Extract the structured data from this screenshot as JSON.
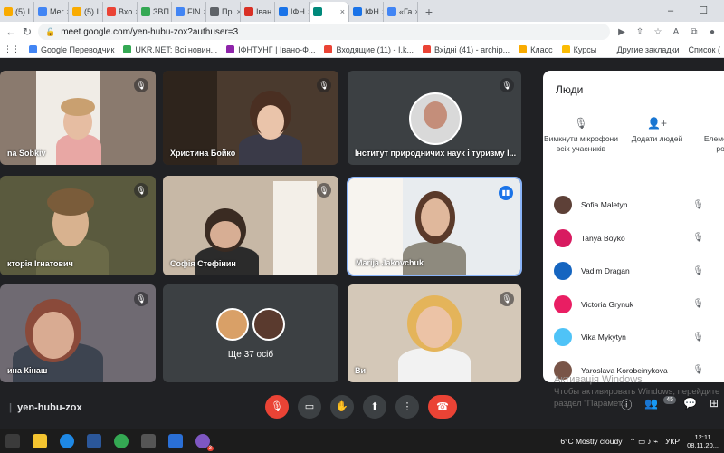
{
  "browser": {
    "tabs": [
      {
        "label": "(5) I",
        "color": "#f9ab00"
      },
      {
        "label": "Mer",
        "color": "#4285f4"
      },
      {
        "label": "(5) I",
        "color": "#f9ab00"
      },
      {
        "label": "Вхо",
        "color": "#ea4335"
      },
      {
        "label": "ЗВП",
        "color": "#34a853"
      },
      {
        "label": "FIN",
        "color": "#4285f4"
      },
      {
        "label": "Прі",
        "color": "#5f6368"
      },
      {
        "label": "Іван",
        "color": "#d93025"
      },
      {
        "label": "ІФН",
        "color": "#1a73e8"
      },
      {
        "label": "",
        "color": "#00897b",
        "active": true
      },
      {
        "label": "ІФН",
        "color": "#1a73e8"
      },
      {
        "label": "«Га",
        "color": "#4285f4"
      }
    ],
    "new_tab": "+",
    "window_controls": [
      "‒",
      "☐"
    ],
    "url": "meet.google.com/yen-hubu-zox?authuser=3"
  },
  "bookmarks": {
    "items": [
      {
        "label": "Google Переводчик",
        "color": "#4285f4"
      },
      {
        "label": "UKR.NET: Всі новин...",
        "color": "#34a853"
      },
      {
        "label": "ІФНТУНГ | Івано-Ф...",
        "color": "#8e24aa"
      },
      {
        "label": "Входящие (11) - I.k...",
        "color": "#ea4335"
      },
      {
        "label": "Вхідні (41) - archip...",
        "color": "#ea4335"
      },
      {
        "label": "Класс",
        "color": "#f9ab00"
      },
      {
        "label": "Курсы",
        "color": "#fbbc04"
      }
    ],
    "right": [
      "Другие закладки",
      "Список ("
    ]
  },
  "tiles": [
    {
      "name": "na Sobkiv",
      "mic_off": true
    },
    {
      "name": "Христина Бойко",
      "mic_off": true
    },
    {
      "name": "Інститут природничих наук і туризму І...",
      "mic_off": true
    },
    {
      "name": "кторія Ігнатович",
      "mic_off": true
    },
    {
      "name": "Софія Стефінин",
      "mic_off": true
    },
    {
      "name": "Marija Jakovchuk",
      "speaking": true
    },
    {
      "name": "ина Кінаш",
      "mic_off": true
    },
    {
      "name": "Ще 37 осіб"
    },
    {
      "name": "Ви",
      "mic_off": true
    }
  ],
  "meeting": {
    "code": "yen-hubu-zox",
    "participants_badge": "45"
  },
  "people_panel": {
    "title": "Люди",
    "actions": [
      {
        "icon": "mic-off-icon",
        "label": "Вимкнути мікрофони всіх учасників"
      },
      {
        "icon": "add-person-icon",
        "label": "Додати людей"
      },
      {
        "icon": "controls-icon",
        "label": "Елемен керуван розміщен"
      }
    ],
    "participants": [
      {
        "name": "Sofia Maletyn",
        "color": "#5d4037"
      },
      {
        "name": "Tanya Boyko",
        "color": "#d81b60"
      },
      {
        "name": "Vadim Dragan",
        "color": "#1565c0"
      },
      {
        "name": "Victoria Grynuk",
        "color": "#e91e63"
      },
      {
        "name": "Vika Mykytyn",
        "color": "#4fc3f7"
      },
      {
        "name": "Yaroslava Korobeinykova",
        "color": "#795548"
      }
    ]
  },
  "watermark": {
    "title": "Активація Windows",
    "line1": "Чтобы активировать Windows, перейдите",
    "line2": "раздел \"Парамет..."
  },
  "taskbar": {
    "viber_badge": "3",
    "weather": "6°C  Mostly cloudy",
    "lang": "УКР",
    "time": "12:11",
    "date": "08.11.20..."
  }
}
